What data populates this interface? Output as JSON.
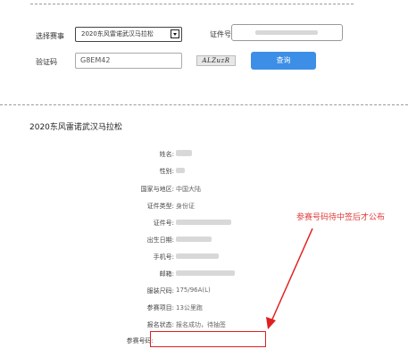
{
  "form": {
    "race_label": "选择赛事",
    "race_value": "2020东风雷诺武汉马拉松",
    "id_label": "证件号",
    "code_label": "验证码",
    "code_value": "G8EM42",
    "captcha_text": "ALZuzR",
    "query_label": "查询"
  },
  "result": {
    "race_title": "2020东风雷诺武汉马拉松",
    "rows": [
      {
        "label": "姓名:",
        "value": ""
      },
      {
        "label": "性别:",
        "value": ""
      },
      {
        "label": "国家与地区:",
        "value": "中国大陆"
      },
      {
        "label": "证件类型:",
        "value": "身份证"
      },
      {
        "label": "证件号:",
        "value": ""
      },
      {
        "label": "出生日期:",
        "value": ""
      },
      {
        "label": "手机号:",
        "value": ""
      },
      {
        "label": "邮箱:",
        "value": ""
      },
      {
        "label": "服装尺码:",
        "value": "175/96A(L)"
      },
      {
        "label": "参赛项目:",
        "value": "13公里跑"
      },
      {
        "label": "报名状态:",
        "value": "报名成功，待抽签"
      },
      {
        "label": "参赛号码:",
        "value": ""
      }
    ]
  },
  "annotation": {
    "text": "参赛号码待中签后才公布",
    "color": "#e23b3b"
  }
}
